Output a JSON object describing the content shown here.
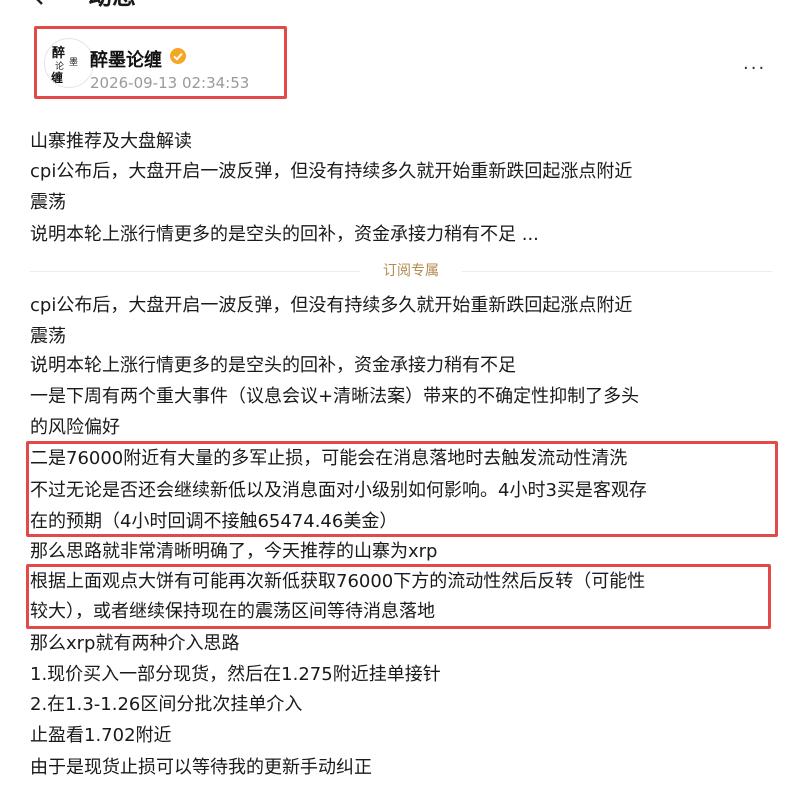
{
  "header": {
    "title": "动态"
  },
  "author": {
    "name": "醉墨论缠",
    "timestamp": "2026-09-13 02:34:53",
    "avatar_text": "醉墨论缠"
  },
  "preview": [
    "山寨推荐及大盘解读",
    "cpi公布后，大盘开启一波反弹，但没有持续多久就开始重新跌回起涨点附近",
    "震荡",
    "说明本轮上涨行情更多的是空头的回补，资金承接力稍有不足 ..."
  ],
  "divider_label": "订阅专属",
  "body": [
    "cpi公布后，大盘开启一波反弹，但没有持续多久就开始重新跌回起涨点附近",
    "震荡",
    "说明本轮上涨行情更多的是空头的回补，资金承接力稍有不足",
    "一是下周有两个重大事件（议息会议+清晰法案）带来的不确定性抑制了多头",
    "的风险偏好",
    "二是76000附近有大量的多军止损，可能会在消息落地时去触发流动性清洗",
    "不过无论是否还会继续新低以及消息面对小级别如何影响。4小时3买是客观存",
    "在的预期（4小时回调不接触65474.46美金）",
    "那么思路就非常清晰明确了，今天推荐的山寨为xrp",
    "根据上面观点大饼有可能再次新低获取76000下方的流动性然后反转（可能性",
    "较大），或者继续保持现在的震荡区间等待消息落地",
    "那么xrp就有两种介入思路",
    "1.现价买入一部分现货，然后在1.275附近挂单接针",
    "2.在1.3-1.26区间分批次挂单介入",
    "止盈看1.702附近",
    "由于是现货止损可以等待我的更新手动纠正"
  ],
  "colors": {
    "highlight_box": "#e24a4a",
    "divider_label": "#b48a4e",
    "timestamp": "#9a9a9a",
    "verified": "#f5a623"
  }
}
